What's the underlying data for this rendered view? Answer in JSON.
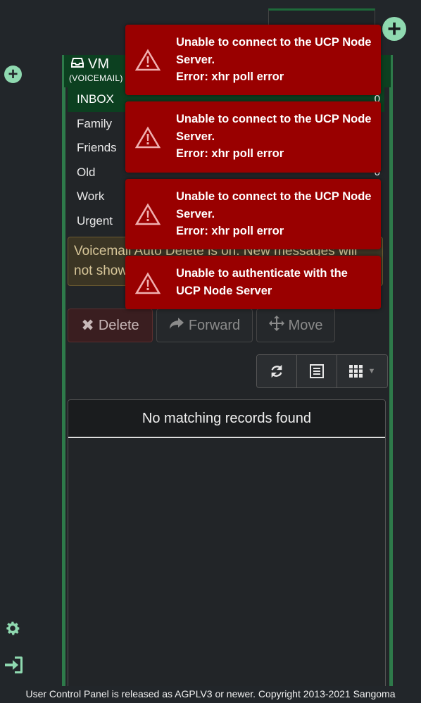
{
  "colors": {
    "background": "#22262a",
    "accent": "#8fd9b0",
    "header": "#0c4020",
    "toast": "#990000"
  },
  "vm": {
    "title": "VM",
    "subtitle": "(VOICEMAIL)",
    "icon": "inbox-icon"
  },
  "folders": [
    {
      "label": "INBOX",
      "count": "0",
      "active": true
    },
    {
      "label": "Family",
      "count": ""
    },
    {
      "label": "Friends",
      "count": ""
    },
    {
      "label": "Old",
      "count": "0"
    },
    {
      "label": "Work",
      "count": ""
    },
    {
      "label": "Urgent",
      "count": ""
    }
  ],
  "warning": {
    "line1": "Voicemail Auto Delete is on. New messages will",
    "line2": "not show"
  },
  "actions": {
    "delete": "Delete",
    "forward": "Forward",
    "move": "Move"
  },
  "table": {
    "empty_text": "No matching records found"
  },
  "toasts": [
    {
      "line1": "Unable to connect to the UCP Node",
      "line2": "Server.",
      "line3": "Error: xhr poll error"
    },
    {
      "line1": "Unable to connect to the UCP Node",
      "line2": "Server.",
      "line3": "Error: xhr poll error"
    },
    {
      "line1": "Unable to connect to the UCP Node",
      "line2": "Server.",
      "line3": "Error: xhr poll error"
    },
    {
      "line1": "Unable to authenticate with the",
      "line2": "UCP Node Server"
    }
  ],
  "footer": {
    "text": "User Control Panel is released as AGPLV3 or newer. Copyright 2013-2021 Sangoma"
  }
}
